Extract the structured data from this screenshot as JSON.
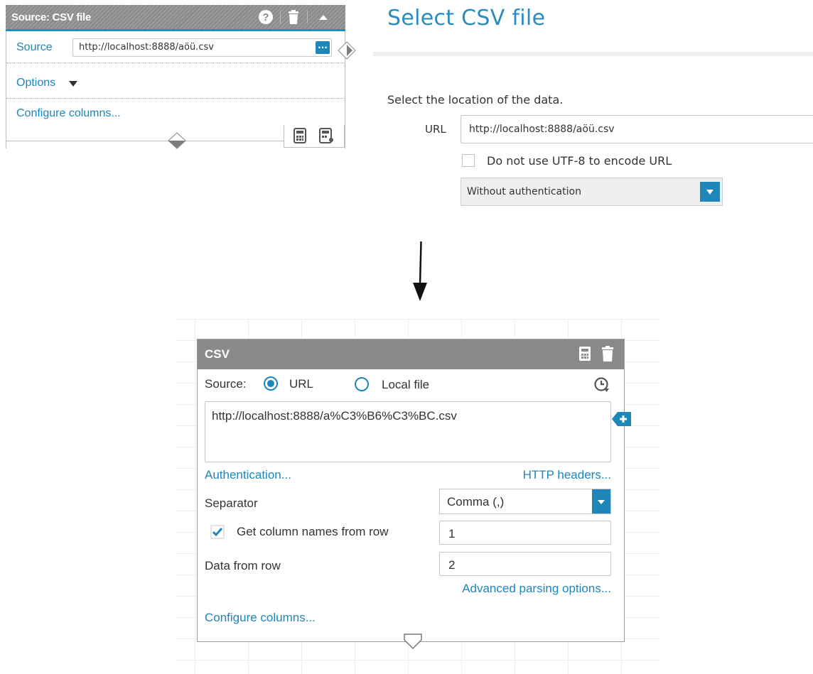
{
  "old_node": {
    "title": "Source: CSV file",
    "source_label": "Source",
    "source_value": "http://localhost:8888/aöü.csv",
    "browse_label": "...",
    "options_label": "Options",
    "configure_label": "Configure columns..."
  },
  "select_panel": {
    "title": "Select CSV file",
    "prompt": "Select the location of the data.",
    "url_label": "URL",
    "url_value": "http://localhost:8888/aöü.csv",
    "utf8_label": "Do not use UTF-8 to encode URL",
    "auth_selected": "Without authentication"
  },
  "csv_node": {
    "title": "CSV",
    "source_label": "Source:",
    "option_url": "URL",
    "option_local": "Local file",
    "url_value": "http://localhost:8888/a%C3%B6%C3%BC.csv",
    "authentication_link": "Authentication...",
    "headers_link": "HTTP headers...",
    "separator_label": "Separator",
    "separator_value": "Comma (,)",
    "column_names_label": "Get column names from row",
    "column_names_row": "1",
    "data_from_label": "Data from row",
    "data_from_row": "2",
    "advanced_link": "Advanced parsing options...",
    "configure_link": "Configure columns..."
  },
  "colors": {
    "accent": "#1e86b9",
    "header_gray": "#8a8a8a"
  },
  "icons": [
    "help-icon",
    "trash-icon",
    "collapse-icon",
    "calculator-icon",
    "history-icon",
    "add-icon",
    "arrow-down-icon"
  ]
}
